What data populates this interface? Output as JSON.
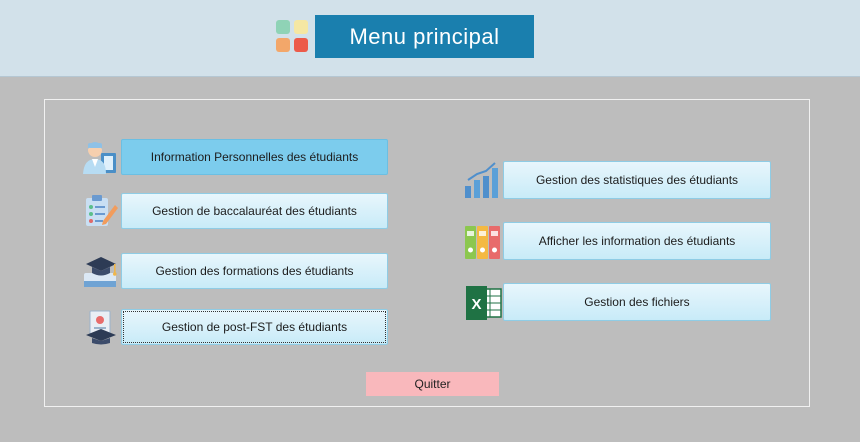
{
  "header": {
    "title": "Menu principal",
    "logo_colors": [
      "#8fd3b6",
      "#f5e7a3",
      "#f3a76a",
      "#ec5b4a"
    ]
  },
  "left_buttons": [
    {
      "label": "Information Personnelles des étudiants",
      "icon": "student-profile-icon",
      "state": "active"
    },
    {
      "label": "Gestion de baccalauréat des étudiants",
      "icon": "checklist-icon",
      "state": "normal"
    },
    {
      "label": "Gestion des formations des étudiants",
      "icon": "graduation-cap-icon",
      "state": "normal"
    },
    {
      "label": "Gestion de post-FST des étudiants",
      "icon": "diploma-icon",
      "state": "focused"
    }
  ],
  "right_buttons": [
    {
      "label": "Gestion des statistiques des étudiants",
      "icon": "bar-chart-icon"
    },
    {
      "label": "Afficher les information des étudiants",
      "icon": "binders-icon"
    },
    {
      "label": "Gestion des fichiers",
      "icon": "excel-icon"
    }
  ],
  "quit_label": "Quitter",
  "colors": {
    "header_bg": "#d2e1ea",
    "title_bg": "#1a7fae",
    "body_bg": "#bdbdbd",
    "button_active": "#7ccced",
    "quit_bg": "#f9b8bc"
  }
}
